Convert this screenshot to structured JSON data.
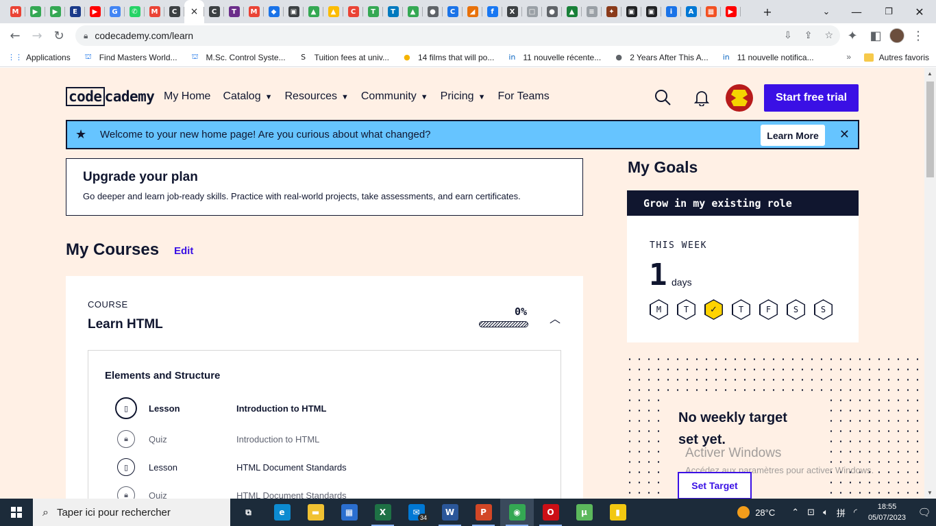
{
  "browser": {
    "tabs": [
      {
        "icon": "gmail-icon",
        "letter": "M",
        "color": "#ea4335"
      },
      {
        "icon": "classroom-icon",
        "letter": "▶",
        "color": "#34a853"
      },
      {
        "icon": "classroom-icon",
        "letter": "▶",
        "color": "#34a853"
      },
      {
        "icon": "enka-icon",
        "letter": "E",
        "color": "#1a3a8a"
      },
      {
        "icon": "youtube-icon",
        "letter": "▶",
        "color": "#ff0000"
      },
      {
        "icon": "google-icon",
        "letter": "G",
        "color": "#4285f4"
      },
      {
        "icon": "whatsapp-icon",
        "letter": "✆",
        "color": "#25d366"
      },
      {
        "icon": "gmail-icon",
        "letter": "M",
        "color": "#ea4335"
      },
      {
        "icon": "codecademy-icon",
        "letter": "C",
        "color": "#3c4043"
      },
      {
        "icon": "codecademy-icon",
        "letter": "C",
        "color": "#3c4043"
      },
      {
        "icon": "trello-icon",
        "letter": "T",
        "color": "#6b2d8a"
      },
      {
        "icon": "gmail-icon",
        "letter": "M",
        "color": "#ea4335"
      },
      {
        "icon": "gemini-icon",
        "letter": "◆",
        "color": "#1a73e8"
      },
      {
        "icon": "contacts-icon",
        "letter": "▣",
        "color": "#3c4043"
      },
      {
        "icon": "drive-icon",
        "letter": "▲",
        "color": "#34a853"
      },
      {
        "icon": "drive-icon",
        "letter": "▲",
        "color": "#fbbc04"
      },
      {
        "icon": "c-red-icon",
        "letter": "C",
        "color": "#ea4335"
      },
      {
        "icon": "trello-icon",
        "letter": "T",
        "color": "#34a853"
      },
      {
        "icon": "trello-icon",
        "letter": "T",
        "color": "#0079bf"
      },
      {
        "icon": "drive-icon",
        "letter": "▲",
        "color": "#34a853"
      },
      {
        "icon": "globe-icon",
        "letter": "●",
        "color": "#5f6368"
      },
      {
        "icon": "c-blue-icon",
        "letter": "C",
        "color": "#1a73e8"
      },
      {
        "icon": "arrow-icon",
        "letter": "◢",
        "color": "#e8710a"
      },
      {
        "icon": "facebook-icon",
        "letter": "f",
        "color": "#1877f2"
      },
      {
        "icon": "vx-icon",
        "letter": "X",
        "color": "#3c4043"
      },
      {
        "icon": "doc-icon",
        "letter": "□",
        "color": "#9aa0a6"
      },
      {
        "icon": "globe-icon",
        "letter": "●",
        "color": "#5f6368"
      },
      {
        "icon": "cap-icon",
        "letter": "▲",
        "color": "#188038"
      },
      {
        "icon": "doc-icon",
        "letter": "≡",
        "color": "#9aa0a6"
      },
      {
        "icon": "crest-icon",
        "letter": "✦",
        "color": "#8a3a1a"
      },
      {
        "icon": "tab-icon",
        "letter": "▣",
        "color": "#202124"
      },
      {
        "icon": "tab-icon",
        "letter": "▣",
        "color": "#202124"
      },
      {
        "icon": "info-icon",
        "letter": "i",
        "color": "#1a73e8"
      },
      {
        "icon": "azure-icon",
        "letter": "A",
        "color": "#0078d4"
      },
      {
        "icon": "microsoft-icon",
        "letter": "▦",
        "color": "#f25022"
      },
      {
        "icon": "youtube-icon",
        "letter": "▶",
        "color": "#ff0000"
      }
    ],
    "active_tab_symbol": "×",
    "new_tab_symbol": "+",
    "url": "codecademy.com/learn",
    "bookmarks": [
      {
        "label": "Applications",
        "icon": "apps-grid-icon",
        "glyph": "⋮⋮",
        "color": "#1a73e8"
      },
      {
        "label": "Find Masters World...",
        "icon": "university-icon",
        "glyph": "⛫",
        "color": "#1a73e8"
      },
      {
        "label": "M.Sc. Control Syste...",
        "icon": "university-icon",
        "glyph": "⛫",
        "color": "#1a73e8"
      },
      {
        "label": "Tuition fees at univ...",
        "icon": "studyportal-icon",
        "glyph": "S",
        "color": "#202124"
      },
      {
        "label": "14 films that will po...",
        "icon": "bulb-icon",
        "glyph": "●",
        "color": "#f5b400"
      },
      {
        "label": "11 nouvelle récente...",
        "icon": "linkedin-icon",
        "glyph": "in",
        "color": "#0a66c2"
      },
      {
        "label": "2 Years After This A...",
        "icon": "globe-icon",
        "glyph": "●",
        "color": "#5f6368"
      },
      {
        "label": "11 nouvelle notifica...",
        "icon": "linkedin-icon",
        "glyph": "in",
        "color": "#0a66c2"
      }
    ],
    "bookmarks_more": "»",
    "other_bookmarks": "Autres favoris"
  },
  "site": {
    "logo_left": "code",
    "logo_right": "cademy",
    "nav": [
      {
        "label": "My Home",
        "dropdown": false
      },
      {
        "label": "Catalog",
        "dropdown": true
      },
      {
        "label": "Resources",
        "dropdown": true
      },
      {
        "label": "Community",
        "dropdown": true
      },
      {
        "label": "Pricing",
        "dropdown": true
      },
      {
        "label": "For Teams",
        "dropdown": false
      }
    ],
    "caret": "▼",
    "cta": "Start free trial"
  },
  "banner": {
    "message": "Welcome to your new home page! Are you curious about what changed?",
    "button": "Learn More",
    "close": "✕"
  },
  "upgrade": {
    "title": "Upgrade your plan",
    "text": "Go deeper and learn job-ready skills. Practice with real-world projects, take assessments, and earn certificates."
  },
  "courses": {
    "title": "My Courses",
    "edit": "Edit",
    "course": {
      "kind": "COURSE",
      "name": "Learn HTML",
      "progress_label": "0%",
      "progress_fraction": 0,
      "module": {
        "title": "Elements and Structure",
        "items": [
          {
            "type": "Lesson",
            "title": "Introduction to HTML",
            "state": "current"
          },
          {
            "type": "Quiz",
            "title": "Introduction to HTML",
            "state": "locked"
          },
          {
            "type": "Lesson",
            "title": "HTML Document Standards",
            "state": "normal"
          },
          {
            "type": "Quiz",
            "title": "HTML Document Standards",
            "state": "locked"
          }
        ]
      }
    }
  },
  "goals": {
    "title": "My Goals",
    "goal": "Grow in my existing role",
    "week_label": "THIS WEEK",
    "days_count": "1",
    "days_unit": "days",
    "days": [
      {
        "label": "M",
        "done": false
      },
      {
        "label": "T",
        "done": false
      },
      {
        "label": "✓",
        "done": true
      },
      {
        "label": "T",
        "done": false
      },
      {
        "label": "F",
        "done": false
      },
      {
        "label": "S",
        "done": false
      },
      {
        "label": "S",
        "done": false
      }
    ],
    "no_target_line1": "No weekly target",
    "no_target_line2": "set yet.",
    "set_target": "Set Target"
  },
  "watermark": {
    "line1": "Activer Windows",
    "line2": "Accédez aux paramètres pour activer Windows."
  },
  "taskbar": {
    "search_placeholder": "Taper ici pour rechercher",
    "apps": [
      {
        "name": "task-view-icon",
        "glyph": "⧉",
        "color": "transparent",
        "running": false
      },
      {
        "name": "edge-icon",
        "glyph": "e",
        "color": "#0c8bd1",
        "running": false
      },
      {
        "name": "file-explorer-icon",
        "glyph": "▬",
        "color": "#f1c232",
        "running": false
      },
      {
        "name": "store-icon",
        "glyph": "▦",
        "color": "#2b6fcf",
        "running": false
      },
      {
        "name": "excel-icon",
        "glyph": "X",
        "color": "#1e7145",
        "running": true
      },
      {
        "name": "mail-icon",
        "glyph": "✉",
        "color": "#0078d4",
        "running": false,
        "badge": "34"
      },
      {
        "name": "word-icon",
        "glyph": "W",
        "color": "#2b579a",
        "running": true
      },
      {
        "name": "powerpoint-icon",
        "glyph": "P",
        "color": "#d24726",
        "running": true
      },
      {
        "name": "chrome-icon",
        "glyph": "◉",
        "color": "#34a853",
        "running": true,
        "active": true
      },
      {
        "name": "opera-icon",
        "glyph": "O",
        "color": "#cc0f16",
        "running": true
      },
      {
        "name": "utorrent-icon",
        "glyph": "µ",
        "color": "#5cb85c",
        "running": false
      },
      {
        "name": "powerbi-icon",
        "glyph": "▮",
        "color": "#f2c811",
        "running": false
      }
    ],
    "temperature": "28°C",
    "time": "18:55",
    "date": "05/07/2023"
  }
}
